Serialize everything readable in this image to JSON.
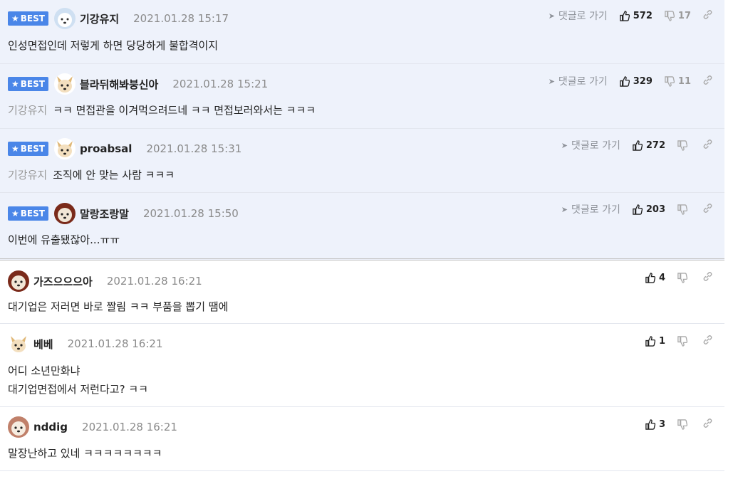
{
  "ui": {
    "best_label": "BEST",
    "reply_label": "댓글로 가기"
  },
  "comments": [
    {
      "best": true,
      "nick": "기강유지",
      "date": "2021.01.28 15:17",
      "up": "572",
      "down": "17",
      "mention": "",
      "lines": [
        "인성면접인데 저렇게 하면 당당하게 불합격이지"
      ]
    },
    {
      "best": true,
      "nick": "블라뒤해봐붕신아",
      "date": "2021.01.28 15:21",
      "up": "329",
      "down": "11",
      "mention": "기강유지",
      "lines": [
        "ㅋㅋ 면접관을 이겨먹으려드네 ㅋㅋ 면접보러와서는 ㅋㅋㅋ"
      ]
    },
    {
      "best": true,
      "nick": "proabsal",
      "date": "2021.01.28 15:31",
      "up": "272",
      "down": "",
      "mention": "기강유지",
      "lines": [
        "조직에 안 맞는 사람 ㅋㅋㅋ"
      ]
    },
    {
      "best": true,
      "nick": "말랑조랑말",
      "date": "2021.01.28 15:50",
      "up": "203",
      "down": "",
      "mention": "",
      "lines": [
        "이번에 유출됐잖아...ㅠㅠ"
      ]
    },
    {
      "best": false,
      "nick": "가즈으으으아",
      "date": "2021.01.28 16:21",
      "up": "4",
      "down": "",
      "mention": "",
      "lines": [
        "대기업은 저러면 바로 짤림 ㅋㅋ 부품을 뽑기 땜에"
      ]
    },
    {
      "best": false,
      "nick": "베베",
      "date": "2021.01.28 16:21",
      "up": "1",
      "down": "",
      "mention": "",
      "lines": [
        "어디 소년만화냐",
        "대기업면접에서 저런다고? ㅋㅋ"
      ]
    },
    {
      "best": false,
      "nick": "nddig",
      "date": "2021.01.28 16:21",
      "up": "3",
      "down": "",
      "mention": "",
      "lines": [
        "말장난하고 있네 ㅋㅋㅋㅋㅋㅋㅋㅋ"
      ]
    }
  ]
}
